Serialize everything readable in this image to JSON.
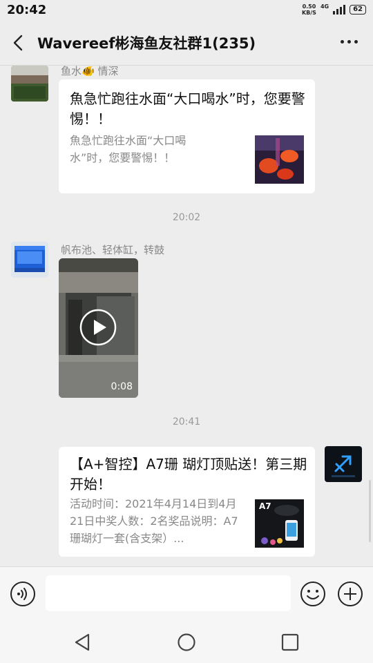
{
  "status_bar": {
    "time": "20:42",
    "speed_value": "0.50",
    "speed_unit": "KB/S",
    "network": "4G",
    "battery": "62"
  },
  "header": {
    "title": "Wavereef彬海鱼友社群1(235)",
    "back_icon": "chevron-left-icon",
    "more_icon": "more-dots-icon"
  },
  "messages": [
    {
      "sender": "鱼水🐠 情深",
      "card_title": "魚急忙跑往水面“大口喝水”时，您要警惕！！",
      "card_desc": "魚急忙跑往水面“大口喝水”时，您要警惕！！"
    },
    {
      "timestamp": "20:02"
    },
    {
      "sender": "帆布池、轻体缸，转鼓",
      "video_duration": "0:08"
    },
    {
      "timestamp": "20:41"
    },
    {
      "card_title": "【A+智控】A7珊 瑚灯顶贴送！第三期开始！",
      "card_desc": "活动时间：2021年4月14日到4月21日中奖人数：2名奖品说明：A7珊瑚灯一套(含支架）...",
      "thumb_label": "A7"
    }
  ],
  "input_bar": {
    "voice_icon": "voice-icon",
    "emoji_icon": "emoji-icon",
    "plus_icon": "plus-icon",
    "placeholder": ""
  },
  "nav_bar": {
    "back": "triangle-back-icon",
    "home": "circle-home-icon",
    "recent": "square-recent-icon"
  },
  "colors": {
    "background": "#ededed",
    "card": "#ffffff",
    "muted_text": "#888888"
  }
}
